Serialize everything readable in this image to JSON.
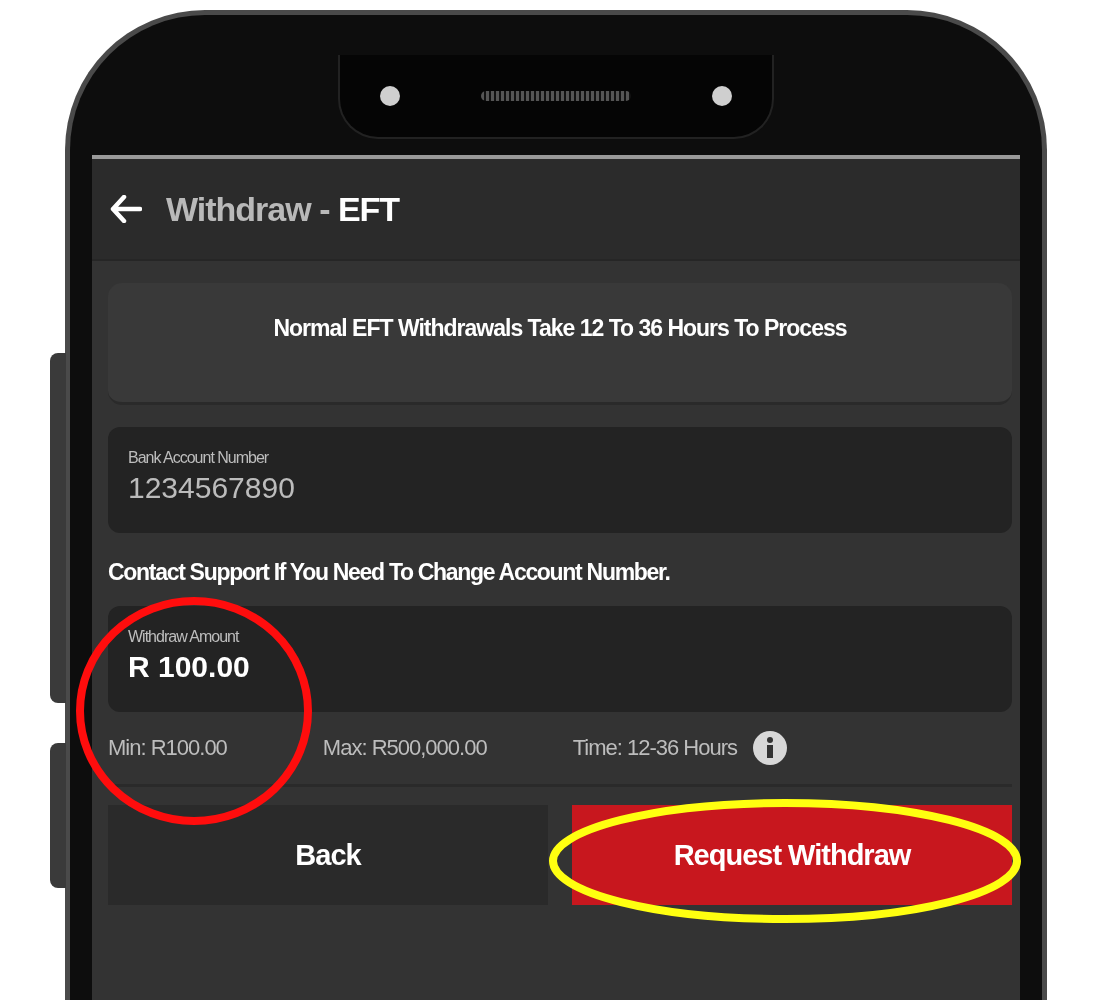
{
  "header": {
    "title": "Withdraw - **EFT**"
  },
  "notice": "Normal EFT Withdrawals Take 12 To 36 Hours To Process",
  "fields": [
    {
      "label": "Bank Account Number",
      "value": "1234567890",
      "disabled": true
    },
    {
      "label": "Withdraw Amount",
      "value": "R 100.00",
      "disabled": false
    }
  ],
  "support_note": "Contact Support If You Need To Change Account Number.",
  "limits": [
    {
      "text": "Min: R100.00",
      "kind": "plain"
    },
    {
      "text": "Max: R500,000.00",
      "kind": "plain"
    },
    {
      "text": "Time: 12-36 Hours",
      "kind": "info"
    }
  ],
  "buttons": [
    {
      "label": "Back",
      "kind": "secondary"
    },
    {
      "label": "Request Withdraw",
      "kind": "primary"
    }
  ]
}
